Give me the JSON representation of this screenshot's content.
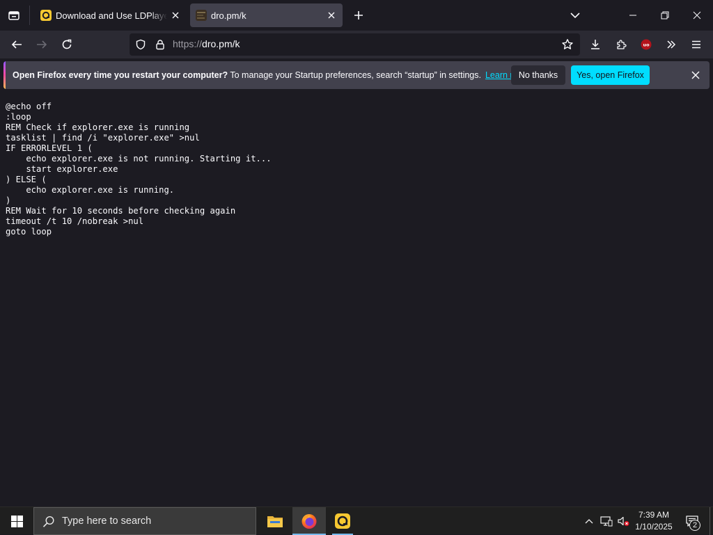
{
  "browser": {
    "tabs": [
      {
        "title": "Download and Use LDPlayer on",
        "favicon": "ldplayer-icon",
        "active": false
      },
      {
        "title": "dro.pm/k",
        "favicon": "site-thumbnail-icon",
        "active": true
      }
    ],
    "url": {
      "scheme": "https://",
      "host_path": "dro.pm/k"
    }
  },
  "notification": {
    "bold_text": "Open Firefox every time you restart your computer?",
    "text": " To manage your Startup preferences, search “startup” in settings.",
    "link": "Learn more",
    "no_button": "No thanks",
    "yes_button": "Yes, open Firefox"
  },
  "page": {
    "code": "@echo off\n:loop\nREM Check if explorer.exe is running\ntasklist | find /i \"explorer.exe\" >nul\nIF ERRORLEVEL 1 (\n    echo explorer.exe is not running. Starting it...\n    start explorer.exe\n) ELSE (\n    echo explorer.exe is running.\n)\nREM Wait for 10 seconds before checking again\ntimeout /t 10 /nobreak >nul\ngoto loop"
  },
  "taskbar": {
    "search_placeholder": "Type here to search",
    "time": "7:39 AM",
    "date": "1/10/2025",
    "notification_count": "2"
  },
  "colors": {
    "accent": "#00ddff",
    "background": "#1c1b22",
    "toolbar": "#2b2a33"
  }
}
